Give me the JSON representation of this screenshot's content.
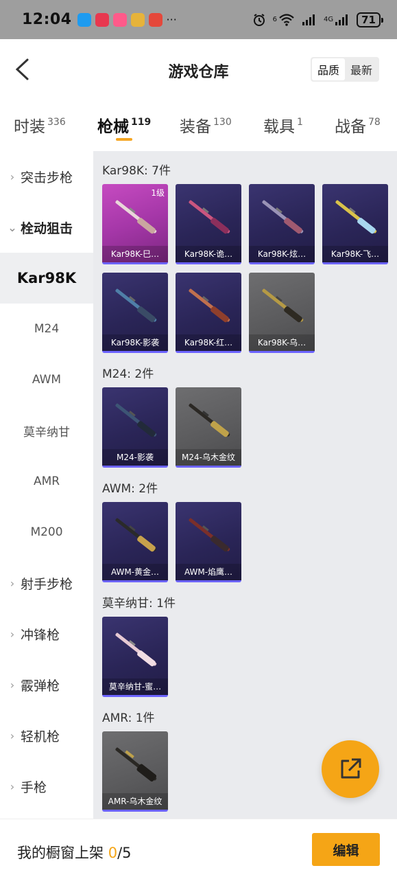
{
  "status_bar": {
    "time": "12:04",
    "battery": "71",
    "more": "···",
    "signal_labels": [
      "6",
      "4G"
    ]
  },
  "header": {
    "title": "游戏仓库",
    "sort_quality": "品质",
    "sort_newest": "最新"
  },
  "tabs": [
    {
      "label": "时装",
      "count": "336"
    },
    {
      "label": "枪械",
      "count": "119"
    },
    {
      "label": "装备",
      "count": "130"
    },
    {
      "label": "载具",
      "count": "1"
    },
    {
      "label": "战备",
      "count": "78"
    }
  ],
  "sidebar": {
    "items": [
      {
        "label": "突击步枪"
      },
      {
        "label": "栓动狙击"
      },
      {
        "label": "Kar98K"
      },
      {
        "label": "M24"
      },
      {
        "label": "AWM"
      },
      {
        "label": "莫辛纳甘"
      },
      {
        "label": "AMR"
      },
      {
        "label": "M200"
      },
      {
        "label": "射手步枪"
      },
      {
        "label": "冲锋枪"
      },
      {
        "label": "霰弹枪"
      },
      {
        "label": "轻机枪"
      },
      {
        "label": "手枪"
      }
    ]
  },
  "sections": [
    {
      "title": "Kar98K: 7件",
      "cards": [
        {
          "label": "Kar98K-巳…",
          "badge": "1级"
        },
        {
          "label": "Kar98K-诡…"
        },
        {
          "label": "Kar98K-炫…"
        },
        {
          "label": "Kar98K-飞…"
        },
        {
          "label": "Kar98K-影袭"
        },
        {
          "label": "Kar98K-红…"
        },
        {
          "label": "Kar98K-乌…"
        }
      ]
    },
    {
      "title": "M24: 2件",
      "cards": [
        {
          "label": "M24-影袭"
        },
        {
          "label": "M24-乌木金纹"
        }
      ]
    },
    {
      "title": "AWM: 2件",
      "cards": [
        {
          "label": "AWM-黄金…"
        },
        {
          "label": "AWM-焰鹰…"
        }
      ]
    },
    {
      "title": "莫辛纳甘: 1件",
      "cards": [
        {
          "label": "莫辛纳甘-蜜…"
        }
      ]
    },
    {
      "title": "AMR: 1件",
      "cards": [
        {
          "label": "AMR-乌木金纹"
        }
      ]
    }
  ],
  "bottom_bar": {
    "label": "我的橱窗上架",
    "used": "0",
    "total": "/5",
    "edit": "编辑"
  },
  "colors": {
    "accent": "#f5a516",
    "card_purple": "#2a2557",
    "card_pink": "#b13db2",
    "card_gray": "#5a5a5c",
    "card_border": "#6c63ff"
  }
}
